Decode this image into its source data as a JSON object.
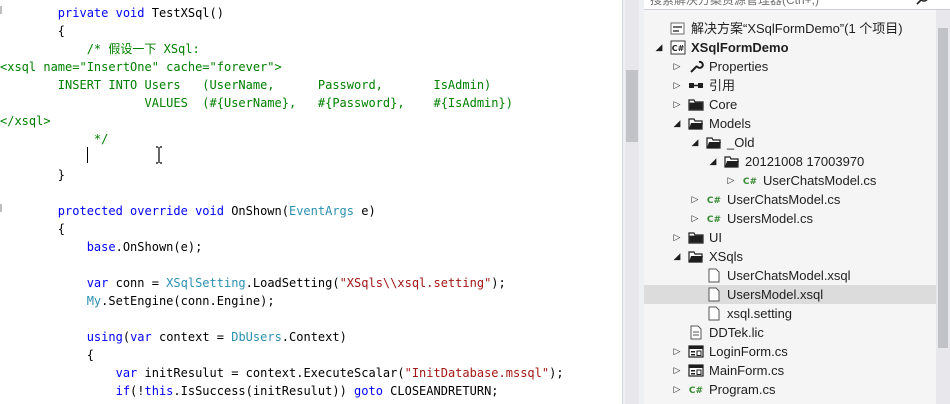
{
  "editor": {
    "lines": [
      [
        {
          "c": "kw",
          "t": "        private void "
        },
        {
          "c": "tx",
          "t": "TestXSql()"
        }
      ],
      [
        {
          "c": "tx",
          "t": "        {"
        }
      ],
      [
        {
          "c": "cm",
          "t": "            /* 假设一下 XSql:"
        }
      ],
      [
        {
          "c": "cm",
          "t": "<xsql name=\"InsertOne\" cache=\"forever\">"
        }
      ],
      [
        {
          "c": "cm",
          "t": "        INSERT INTO Users   (UserName,      Password,       IsAdmin)"
        }
      ],
      [
        {
          "c": "cm",
          "t": "                    VALUES  (#{UserName},   #{Password},    #{IsAdmin})"
        }
      ],
      [
        {
          "c": "cm",
          "t": "</xsql>"
        }
      ],
      [
        {
          "c": "cm",
          "t": "             */"
        }
      ],
      [
        {
          "c": "tx",
          "t": ""
        }
      ],
      [
        {
          "c": "tx",
          "t": "        }"
        }
      ],
      [
        {
          "c": "tx",
          "t": ""
        }
      ],
      [
        {
          "c": "kw",
          "t": "        protected override void "
        },
        {
          "c": "tx",
          "t": "OnShown("
        },
        {
          "c": "ty",
          "t": "EventArgs"
        },
        {
          "c": "tx",
          "t": " e)"
        }
      ],
      [
        {
          "c": "tx",
          "t": "        {"
        }
      ],
      [
        {
          "c": "kw",
          "t": "            base"
        },
        {
          "c": "tx",
          "t": ".OnShown(e);"
        }
      ],
      [
        {
          "c": "tx",
          "t": ""
        }
      ],
      [
        {
          "c": "kw",
          "t": "            var "
        },
        {
          "c": "tx",
          "t": "conn = "
        },
        {
          "c": "ty",
          "t": "XSqlSetting"
        },
        {
          "c": "tx",
          "t": ".LoadSetting("
        },
        {
          "c": "st",
          "t": "\"XSqls\\\\xsql.setting\""
        },
        {
          "c": "tx",
          "t": ");"
        }
      ],
      [
        {
          "c": "ty",
          "t": "            My"
        },
        {
          "c": "tx",
          "t": ".SetEngine(conn.Engine);"
        }
      ],
      [
        {
          "c": "tx",
          "t": ""
        }
      ],
      [
        {
          "c": "kw",
          "t": "            using"
        },
        {
          "c": "tx",
          "t": "("
        },
        {
          "c": "kw",
          "t": "var "
        },
        {
          "c": "tx",
          "t": "context = "
        },
        {
          "c": "ty",
          "t": "DbUsers"
        },
        {
          "c": "tx",
          "t": ".Context)"
        }
      ],
      [
        {
          "c": "tx",
          "t": "            {"
        }
      ],
      [
        {
          "c": "kw",
          "t": "                var "
        },
        {
          "c": "tx",
          "t": "initResulut = context.ExecuteScalar("
        },
        {
          "c": "st",
          "t": "\"InitDatabase.mssql\""
        },
        {
          "c": "tx",
          "t": ");"
        }
      ],
      [
        {
          "c": "kw",
          "t": "                if"
        },
        {
          "c": "tx",
          "t": "(!"
        },
        {
          "c": "kw",
          "t": "this"
        },
        {
          "c": "tx",
          "t": ".IsSuccess(initResulut)) "
        },
        {
          "c": "kw",
          "t": "goto "
        },
        {
          "c": "tx",
          "t": "CLOSEANDRETURN;"
        }
      ]
    ]
  },
  "solution_explorer": {
    "search_placeholder": "搜索解决方案资源管理器(Ctrl+;)",
    "items": [
      {
        "label": "解决方案“XSqlFormDemo”(1 个项目)",
        "icon": "solution-icon",
        "depth": 0,
        "arrow": "none",
        "bold": false
      },
      {
        "label": "XSqlFormDemo",
        "icon": "csharp-project-icon",
        "depth": 0,
        "arrow": "expanded",
        "bold": true
      },
      {
        "label": "Properties",
        "icon": "wrench-icon",
        "depth": 1,
        "arrow": "collapsed",
        "bold": false
      },
      {
        "label": "引用",
        "icon": "references-icon",
        "depth": 1,
        "arrow": "collapsed",
        "bold": false
      },
      {
        "label": "Core",
        "icon": "folder-icon",
        "depth": 1,
        "arrow": "collapsed",
        "bold": false
      },
      {
        "label": "Models",
        "icon": "folder-open-icon",
        "depth": 1,
        "arrow": "expanded",
        "bold": false
      },
      {
        "label": "_Old",
        "icon": "folder-open-icon",
        "depth": 2,
        "arrow": "expanded",
        "bold": false
      },
      {
        "label": "20121008 17003970",
        "icon": "folder-open-icon",
        "depth": 3,
        "arrow": "expanded",
        "bold": false
      },
      {
        "label": "UserChatsModel.cs",
        "icon": "csharp-file-icon",
        "depth": 4,
        "arrow": "collapsed",
        "bold": false
      },
      {
        "label": "UserChatsModel.cs",
        "icon": "csharp-file-icon",
        "depth": 2,
        "arrow": "collapsed",
        "bold": false
      },
      {
        "label": "UsersModel.cs",
        "icon": "csharp-file-icon",
        "depth": 2,
        "arrow": "collapsed",
        "bold": false
      },
      {
        "label": "UI",
        "icon": "folder-icon",
        "depth": 1,
        "arrow": "collapsed",
        "bold": false
      },
      {
        "label": "XSqls",
        "icon": "folder-open-icon",
        "depth": 1,
        "arrow": "expanded",
        "bold": false
      },
      {
        "label": "UserChatsModel.xsql",
        "icon": "file-icon",
        "depth": 2,
        "arrow": "none",
        "bold": false
      },
      {
        "label": "UsersModel.xsql",
        "icon": "file-icon",
        "depth": 2,
        "arrow": "none",
        "bold": false,
        "selected": true
      },
      {
        "label": "xsql.setting",
        "icon": "file-icon",
        "depth": 2,
        "arrow": "none",
        "bold": false
      },
      {
        "label": "DDTek.lic",
        "icon": "lic-file-icon",
        "depth": 1,
        "arrow": "none",
        "bold": false
      },
      {
        "label": "LoginForm.cs",
        "icon": "form-icon",
        "depth": 1,
        "arrow": "collapsed",
        "bold": false
      },
      {
        "label": "MainForm.cs",
        "icon": "form-icon",
        "depth": 1,
        "arrow": "collapsed",
        "bold": false
      },
      {
        "label": "Program.cs",
        "icon": "csharp-file-icon",
        "depth": 1,
        "arrow": "collapsed",
        "bold": false
      }
    ]
  },
  "colors": {
    "keyword": "#0000ff",
    "type": "#2b91af",
    "string": "#a31515",
    "comment": "#008000",
    "selection": "#dcdcdc"
  }
}
